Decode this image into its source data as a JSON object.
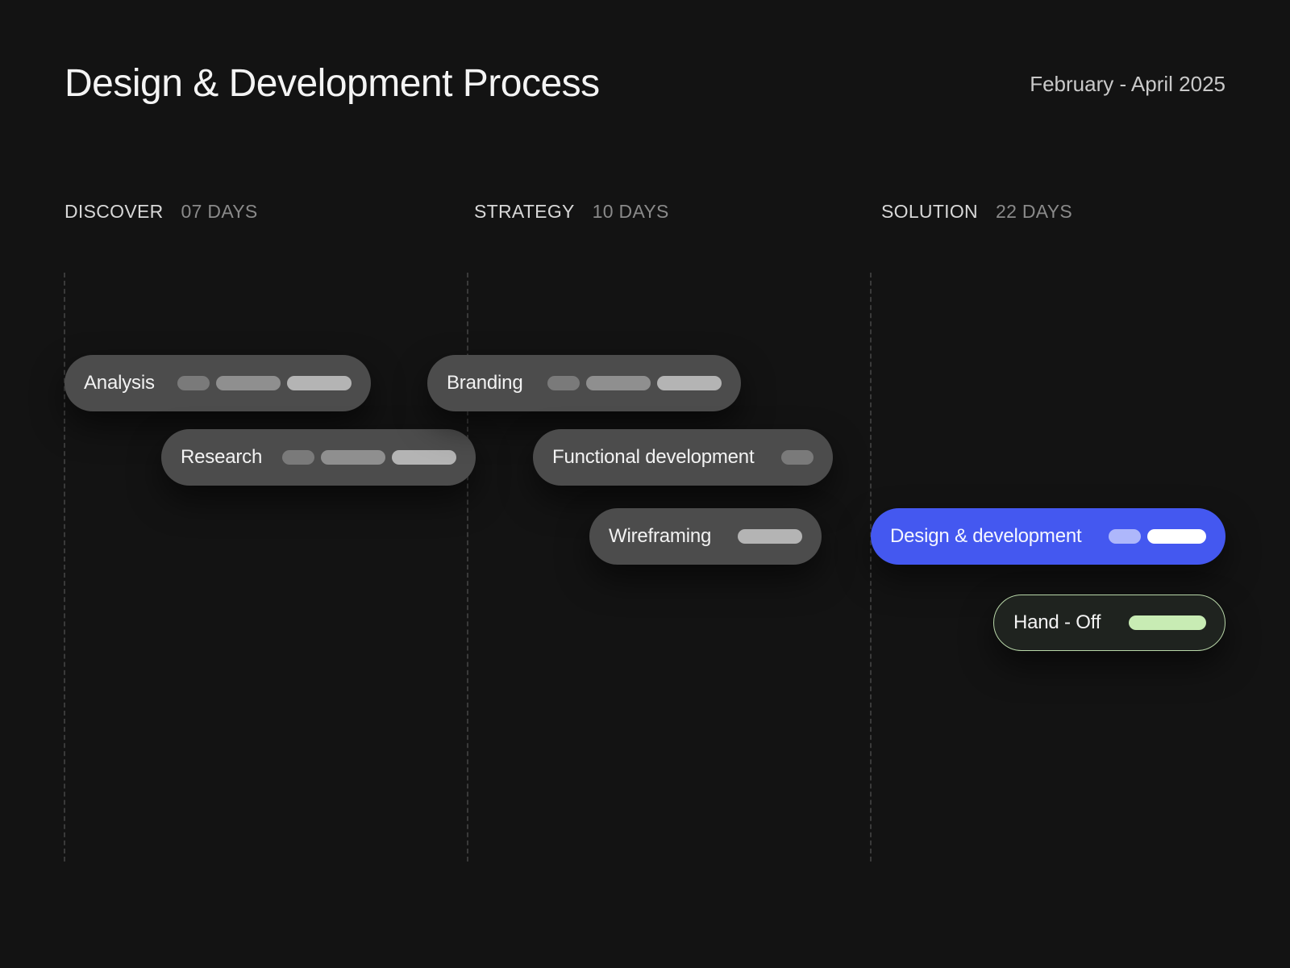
{
  "header": {
    "title": "Design & Development Process",
    "date_range": "February - April 2025"
  },
  "phases": [
    {
      "name": "DISCOVER",
      "days": "07 DAYS"
    },
    {
      "name": "STRATEGY",
      "days": "10 DAYS"
    },
    {
      "name": "SOLUTION",
      "days": "22 DAYS"
    }
  ],
  "tasks": [
    {
      "label": "Analysis",
      "phase": "DISCOVER"
    },
    {
      "label": "Research",
      "phase": "DISCOVER"
    },
    {
      "label": "Branding",
      "phase": "STRATEGY"
    },
    {
      "label": "Functional development",
      "phase": "STRATEGY"
    },
    {
      "label": "Wireframing",
      "phase": "STRATEGY"
    },
    {
      "label": "Design & development",
      "phase": "SOLUTION",
      "highlighted": true
    },
    {
      "label": "Hand - Off",
      "phase": "SOLUTION"
    }
  ],
  "colors": {
    "background": "#131313",
    "pill": "#4c4c4c",
    "accent": "#4458f0",
    "handoff_outline": "#b8d6a8",
    "handoff_bar": "#c8ecb4"
  }
}
